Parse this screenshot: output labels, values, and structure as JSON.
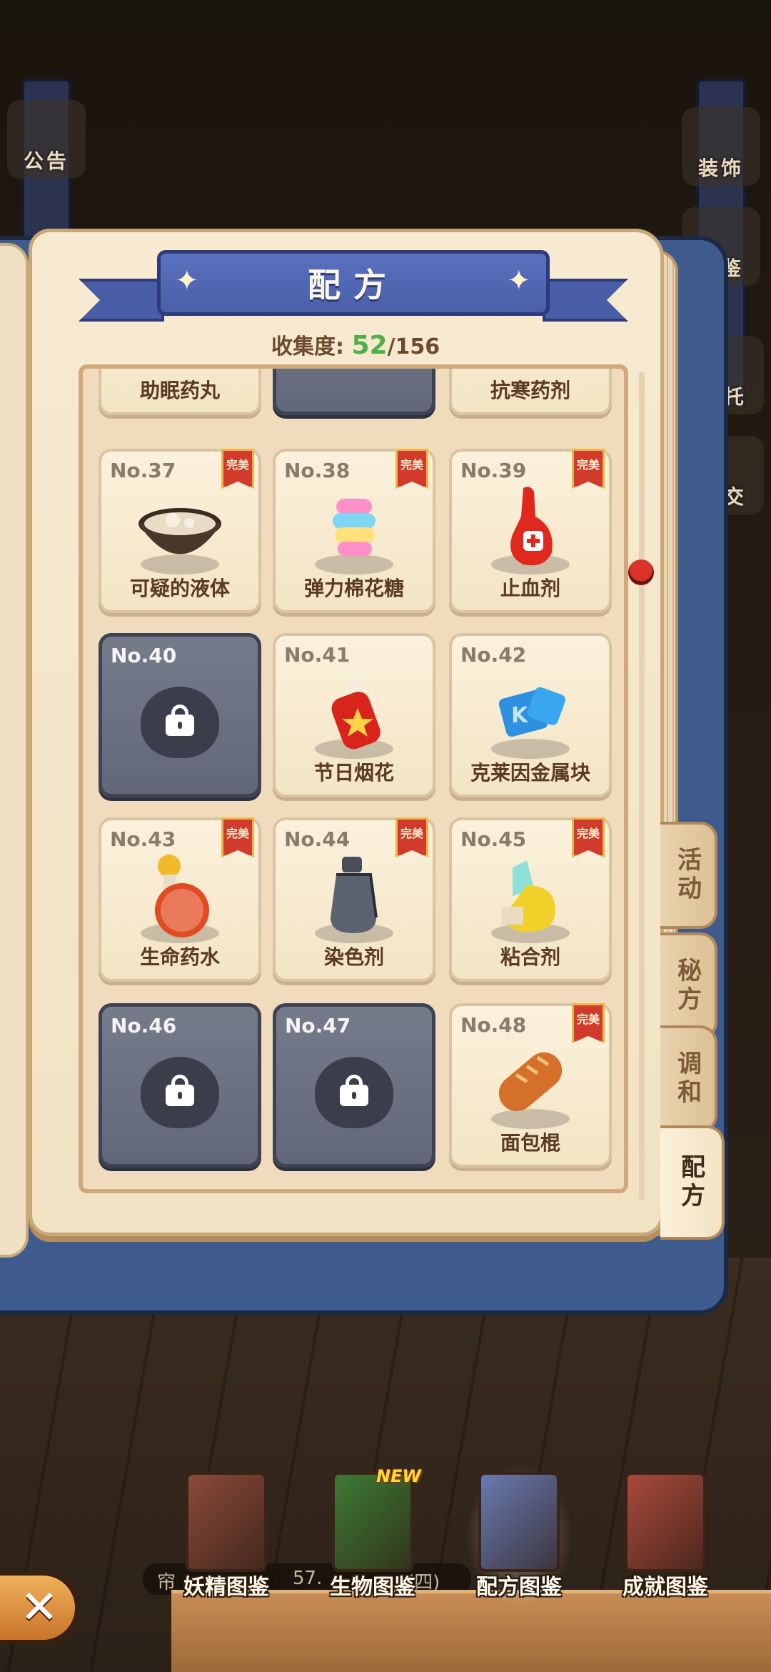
{
  "side_buttons": {
    "left_top": "公告",
    "right_top": "装饰",
    "right_second": "图鉴",
    "right_third": "托",
    "right_fourth": "交"
  },
  "title": "配方",
  "collection": {
    "label": "收集度:",
    "current": "52",
    "total": "/156"
  },
  "top_row": [
    "助眠药丸",
    "",
    "抗寒药剂"
  ],
  "perfect_badge": "完美",
  "recipes": [
    {
      "no": "No.37",
      "name": "可疑的液体",
      "locked": false,
      "perfect": true,
      "icon": "bowl-liquid-icon"
    },
    {
      "no": "No.38",
      "name": "弹力棉花糖",
      "locked": false,
      "perfect": true,
      "icon": "marshmallow-icon"
    },
    {
      "no": "No.39",
      "name": "止血剂",
      "locked": false,
      "perfect": true,
      "icon": "red-potion-icon"
    },
    {
      "no": "No.40",
      "name": "",
      "locked": true,
      "perfect": false,
      "icon": "lock-icon"
    },
    {
      "no": "No.41",
      "name": "节日烟花",
      "locked": false,
      "perfect": false,
      "icon": "firework-icon"
    },
    {
      "no": "No.42",
      "name": "克莱因金属块",
      "locked": false,
      "perfect": false,
      "icon": "metal-block-icon"
    },
    {
      "no": "No.43",
      "name": "生命药水",
      "locked": false,
      "perfect": true,
      "icon": "life-potion-icon"
    },
    {
      "no": "No.44",
      "name": "染色剂",
      "locked": false,
      "perfect": true,
      "icon": "dye-bottle-icon"
    },
    {
      "no": "No.45",
      "name": "粘合剂",
      "locked": false,
      "perfect": true,
      "icon": "glue-icon"
    },
    {
      "no": "No.46",
      "name": "",
      "locked": true,
      "perfect": false,
      "icon": "lock-icon"
    },
    {
      "no": "No.47",
      "name": "",
      "locked": true,
      "perfect": false,
      "icon": "lock-icon"
    },
    {
      "no": "No.48",
      "name": "面包棍",
      "locked": false,
      "perfect": true,
      "icon": "bread-icon"
    }
  ],
  "tabs": [
    "活动",
    "秘方",
    "调和",
    "配方"
  ],
  "active_tab": "配方",
  "bottom_nav": [
    {
      "label": "妖精图鉴",
      "color": "#8a4a3a"
    },
    {
      "label": "生物图鉴",
      "color": "#3f7a34",
      "badge": "NEW"
    },
    {
      "label": "配方图鉴",
      "color": "#6a7ab0"
    },
    {
      "label": "成就图鉴",
      "color": "#a84a3c"
    }
  ],
  "info_strip": {
    "left": "帘",
    "mid": "57.",
    "right": "(四)"
  },
  "colors": {
    "accent": "#4b5fa9",
    "collect_green": "#4fae4a",
    "locked_card": "#62687a"
  }
}
